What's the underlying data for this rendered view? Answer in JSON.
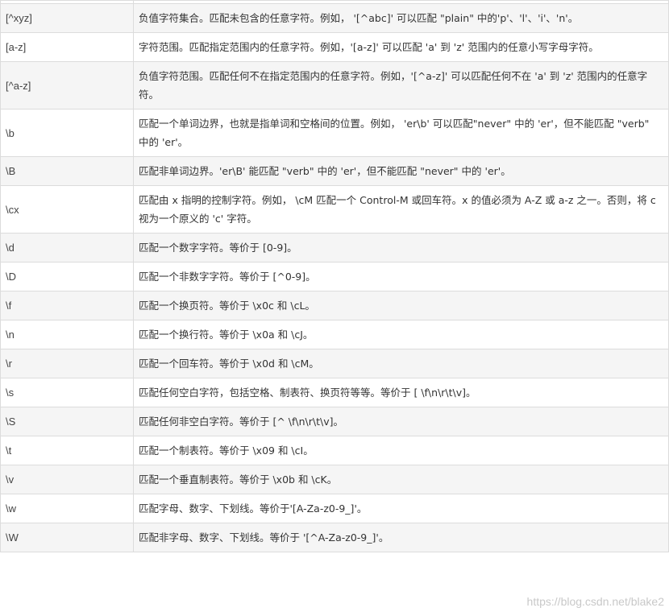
{
  "rows": [
    {
      "char": "[^xyz]",
      "desc": "负值字符集合。匹配未包含的任意字符。例如， '[^abc]' 可以匹配 \"plain\" 中的'p'、'l'、'i'、'n'。"
    },
    {
      "char": "[a-z]",
      "desc": "字符范围。匹配指定范围内的任意字符。例如，'[a-z]' 可以匹配 'a' 到 'z' 范围内的任意小写字母字符。"
    },
    {
      "char": "[^a-z]",
      "desc": "负值字符范围。匹配任何不在指定范围内的任意字符。例如，'[^a-z]' 可以匹配任何不在 'a' 到 'z' 范围内的任意字符。"
    },
    {
      "char": "\\b",
      "desc": "匹配一个单词边界，也就是指单词和空格间的位置。例如， 'er\\b' 可以匹配\"never\" 中的 'er'，但不能匹配 \"verb\" 中的 'er'。"
    },
    {
      "char": "\\B",
      "desc": "匹配非单词边界。'er\\B' 能匹配 \"verb\" 中的 'er'，但不能匹配 \"never\" 中的 'er'。"
    },
    {
      "char": "\\cx",
      "desc": "匹配由 x 指明的控制字符。例如， \\cM 匹配一个 Control-M 或回车符。x 的值必须为 A-Z 或 a-z 之一。否则，将 c 视为一个原义的 'c' 字符。"
    },
    {
      "char": "\\d",
      "desc": "匹配一个数字字符。等价于 [0-9]。"
    },
    {
      "char": "\\D",
      "desc": "匹配一个非数字字符。等价于 [^0-9]。"
    },
    {
      "char": "\\f",
      "desc": "匹配一个换页符。等价于 \\x0c 和 \\cL。"
    },
    {
      "char": "\\n",
      "desc": "匹配一个换行符。等价于 \\x0a 和 \\cJ。"
    },
    {
      "char": "\\r",
      "desc": "匹配一个回车符。等价于 \\x0d 和 \\cM。"
    },
    {
      "char": "\\s",
      "desc": "匹配任何空白字符，包括空格、制表符、换页符等等。等价于 [ \\f\\n\\r\\t\\v]。"
    },
    {
      "char": "\\S",
      "desc": "匹配任何非空白字符。等价于 [^ \\f\\n\\r\\t\\v]。"
    },
    {
      "char": "\\t",
      "desc": "匹配一个制表符。等价于 \\x09 和 \\cI。"
    },
    {
      "char": "\\v",
      "desc": "匹配一个垂直制表符。等价于 \\x0b 和 \\cK。"
    },
    {
      "char": "\\w",
      "desc": "匹配字母、数字、下划线。等价于'[A-Za-z0-9_]'。"
    },
    {
      "char": "\\W",
      "desc": "匹配非字母、数字、下划线。等价于 '[^A-Za-z0-9_]'。"
    }
  ],
  "watermark": "https://blog.csdn.net/blake2"
}
